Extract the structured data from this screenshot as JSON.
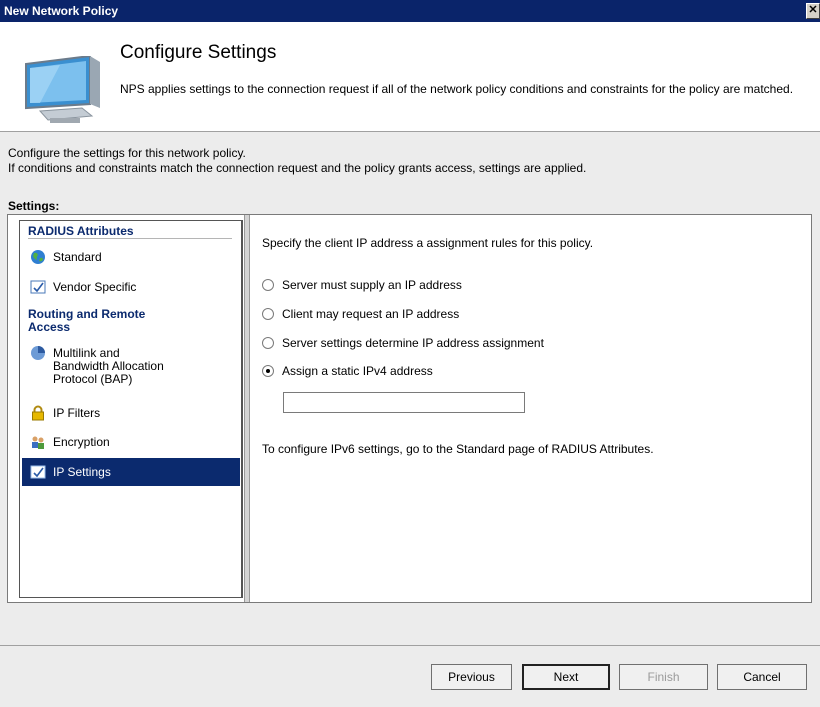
{
  "window": {
    "title": "New Network Policy",
    "close_glyph": "✕"
  },
  "header": {
    "title": "Configure Settings",
    "description": "NPS applies settings to the connection request if all of the network policy conditions and constraints for the policy are matched."
  },
  "intro": {
    "line1": "Configure the settings for this network policy.",
    "line2": "If conditions and constraints match the connection request and the policy grants access, settings are applied."
  },
  "settings_label": "Settings:",
  "nav": {
    "group1": "RADIUS Attributes",
    "standard": "Standard",
    "vendor_specific": "Vendor Specific",
    "group2_line1": "Routing and Remote",
    "group2_line2": "Access",
    "multilink_line1": "Multilink and",
    "multilink_line2": "Bandwidth Allocation",
    "multilink_line3": "Protocol (BAP)",
    "ip_filters": "IP Filters",
    "encryption": "Encryption",
    "ip_settings": "IP Settings",
    "selected": "IP Settings"
  },
  "content": {
    "lead": "Specify the client IP address a assignment rules for this policy.",
    "options": [
      "Server must supply an IP address",
      "Client may request an IP address",
      "Server settings determine IP address assignment",
      "Assign a static IPv4 address"
    ],
    "selected_option": "Assign a static IPv4 address",
    "static_ip_value": "",
    "ipv6_note": "To configure IPv6 settings, go to the Standard page of RADIUS Attributes."
  },
  "buttons": {
    "previous": "Previous",
    "next": "Next",
    "finish": "Finish",
    "cancel": "Cancel"
  },
  "colors": {
    "titlebar": "#0a246a",
    "selection": "#0b2a6e",
    "group_heading": "#0b2a6e"
  },
  "icons": {
    "header": "monitor-icon",
    "standard": "globe-icon",
    "vendor_specific": "checklist-icon",
    "multilink": "pie-icon",
    "ip_filters": "lock-icon",
    "encryption": "users-icon",
    "ip_settings": "checklist-icon"
  }
}
